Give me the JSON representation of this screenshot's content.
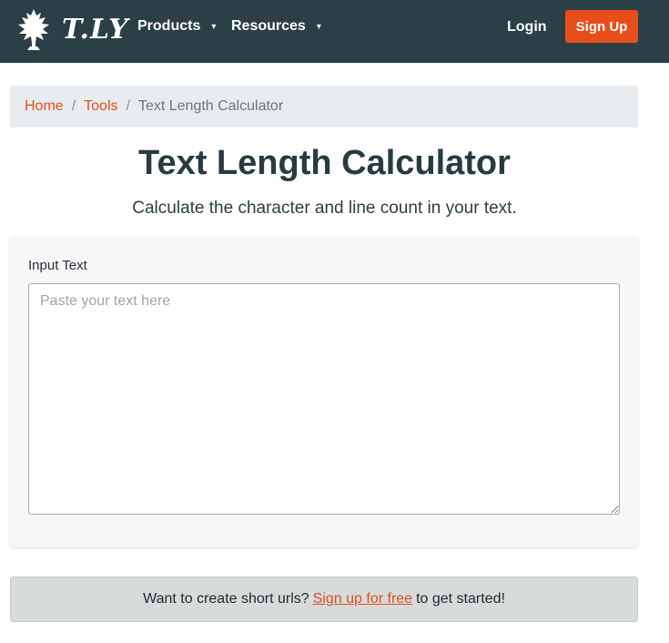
{
  "header": {
    "logo_text": "T.LY",
    "logo_icon": "tree-icon",
    "nav": [
      {
        "label": "Products",
        "caret": "▾"
      },
      {
        "label": "Resources",
        "caret": "▾"
      }
    ],
    "login_label": "Login",
    "signup_label": "Sign Up"
  },
  "breadcrumb": {
    "items": [
      "Home",
      "Tools"
    ],
    "separator": "/",
    "current": "Text Length Calculator"
  },
  "page": {
    "title": "Text Length Calculator",
    "subtitle": "Calculate the character and line count in your text."
  },
  "form": {
    "label": "Input Text",
    "placeholder": "Paste your text here",
    "value": ""
  },
  "promo": {
    "before": "Want to create short urls?",
    "link": "Sign up for free",
    "after": "to get started!"
  },
  "colors": {
    "header_bg": "#2a4046",
    "accent": "#e84e1b",
    "breadcrumb_bg": "#e9ecef",
    "promo_bg": "#d6dcdb"
  }
}
